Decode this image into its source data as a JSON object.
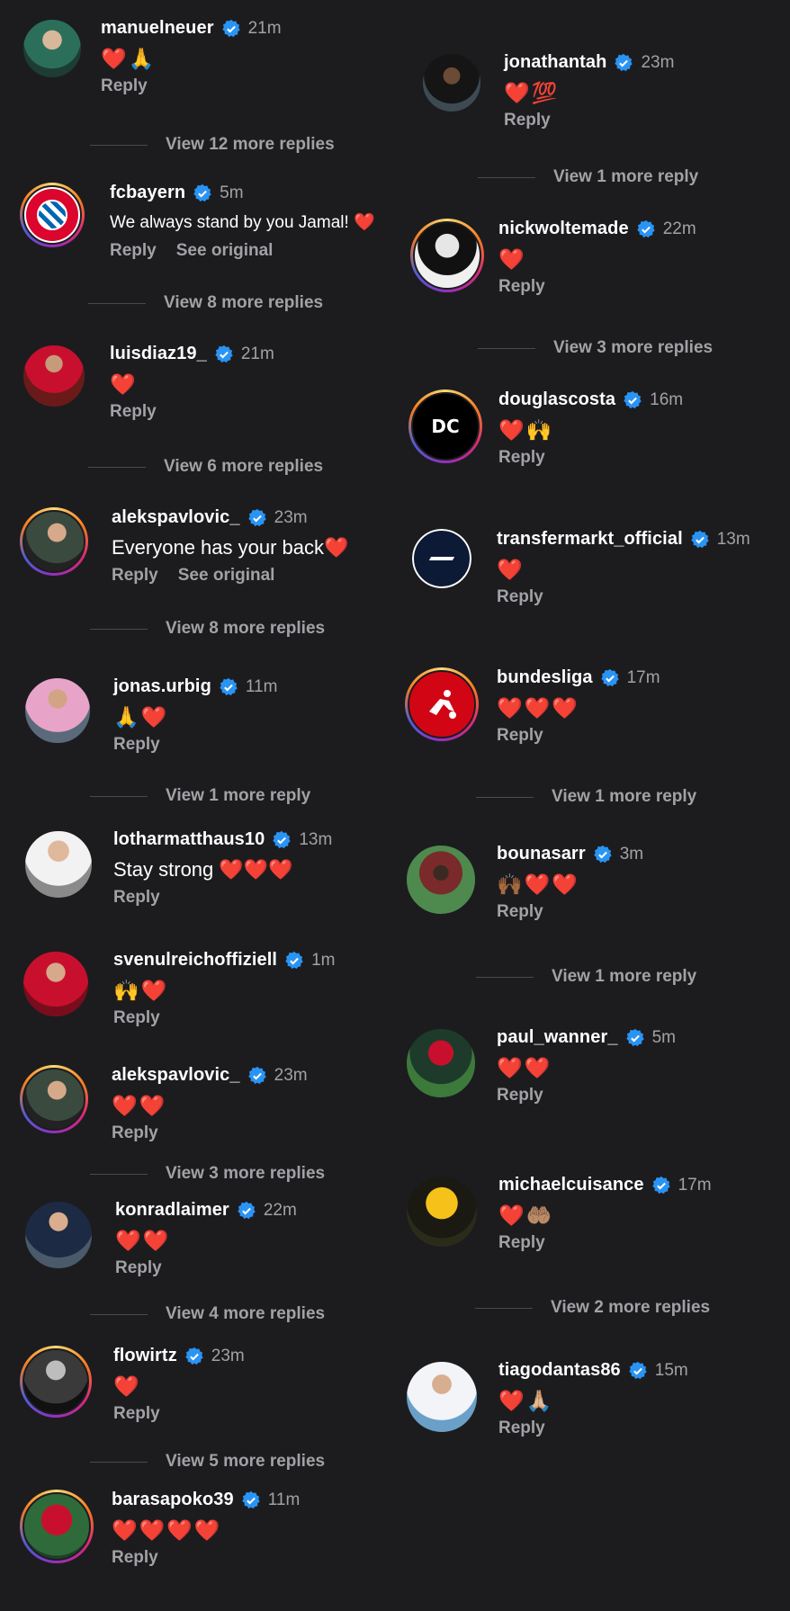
{
  "colors": {
    "background": "#1c1c1f",
    "verified_blue": "#2a94f4",
    "heart_red": "#ff3040",
    "muted": "#a2a2a6"
  },
  "icons": {
    "verified": "verified-badge-icon",
    "heart": "red-heart-emoji",
    "pray": "folded-hands-emoji",
    "raised_hands": "raised-hands-emoji",
    "hundred": "hundred-points-emoji",
    "palms_up": "palms-up-together-emoji"
  },
  "left_column": [
    {
      "username": "manuelneuer",
      "time": "21m",
      "text": "❤️🙏",
      "reply": "Reply",
      "more": "View 12 more replies"
    },
    {
      "username": "fcbayern",
      "time": "5m",
      "text": "We always stand by you Jamal! ❤️",
      "reply": "Reply",
      "see_original": "See original",
      "more": "View 8 more replies",
      "avatar_text": "FC BAYERN MÜNCHEN"
    },
    {
      "username": "luisdiaz19_",
      "time": "21m",
      "text": "❤️",
      "reply": "Reply",
      "more": "View 6 more replies"
    },
    {
      "username": "alekspavlovic_",
      "time": "23m",
      "text": "Everyone has your back❤️",
      "reply": "Reply",
      "see_original": "See original",
      "more": "View 8 more replies"
    },
    {
      "username": "jonas.urbig",
      "time": "11m",
      "text": "🙏❤️",
      "reply": "Reply",
      "more": "View 1 more reply"
    },
    {
      "username": "lotharmatthaus10",
      "time": "13m",
      "text": "Stay strong ❤️❤️❤️",
      "reply": "Reply"
    },
    {
      "username": "svenulreichoffiziell",
      "time": "1m",
      "text": "🙌❤️",
      "reply": "Reply"
    },
    {
      "username": "alekspavlovic_",
      "time": "23m",
      "text": "❤️❤️",
      "reply": "Reply",
      "more": "View 3 more replies"
    },
    {
      "username": "konradlaimer",
      "time": "22m",
      "text": "❤️❤️",
      "reply": "Reply",
      "more": "View 4 more replies"
    },
    {
      "username": "flowirtz",
      "time": "23m",
      "text": "❤️",
      "reply": "Reply",
      "more": "View 5 more replies"
    },
    {
      "username": "barasapoko39",
      "time": "11m",
      "text": "❤️❤️❤️❤️",
      "reply": "Reply"
    }
  ],
  "right_column": [
    {
      "username": "jonathantah",
      "time": "23m",
      "text": "❤️💯",
      "reply": "Reply",
      "more": "View 1 more reply"
    },
    {
      "username": "nickwoltemade",
      "time": "22m",
      "text": "❤️",
      "reply": "Reply",
      "more": "View 3 more replies"
    },
    {
      "username": "douglascosta",
      "time": "16m",
      "text": "❤️🙌",
      "reply": "Reply",
      "avatar_text": "DC"
    },
    {
      "username": "transfermarkt_official",
      "time": "13m",
      "text": "❤️",
      "reply": "Reply"
    },
    {
      "username": "bundesliga",
      "time": "17m",
      "text": "❤️❤️❤️",
      "reply": "Reply",
      "more": "View 1 more reply"
    },
    {
      "username": "bounasarr",
      "time": "3m",
      "text": "🙌🏾❤️❤️",
      "reply": "Reply",
      "more": "View 1 more reply"
    },
    {
      "username": "paul_wanner_",
      "time": "5m",
      "text": "❤️❤️",
      "reply": "Reply"
    },
    {
      "username": "michaelcuisance",
      "time": "17m",
      "text": "❤️🤲🏽",
      "reply": "Reply",
      "more": "View 2 more replies"
    },
    {
      "username": "tiagodantas86",
      "time": "15m",
      "text": "❤️🙏🏼",
      "reply": "Reply"
    }
  ]
}
